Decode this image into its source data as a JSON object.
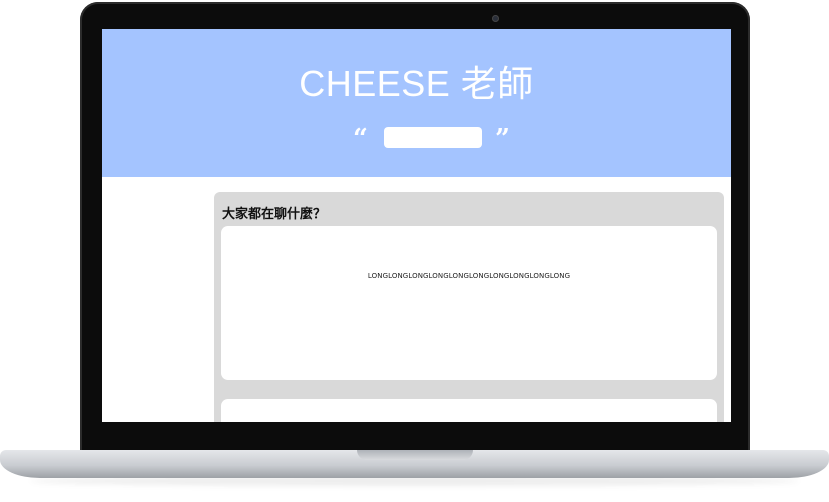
{
  "header": {
    "title": "CHEESE 老師",
    "quote_open": "“",
    "quote_close": "”",
    "quote_input_value": "",
    "background_color": "#a4c4ff"
  },
  "chat": {
    "heading": "大家都在聊什麼？",
    "messages": [
      {
        "text": "LONGLONGLONGLONGLONGLONGLONGLONGLONGLONG"
      },
      {
        "text": ""
      }
    ],
    "panel_color": "#d9d9d9"
  },
  "device": {
    "camera_icon": "camera-icon"
  }
}
